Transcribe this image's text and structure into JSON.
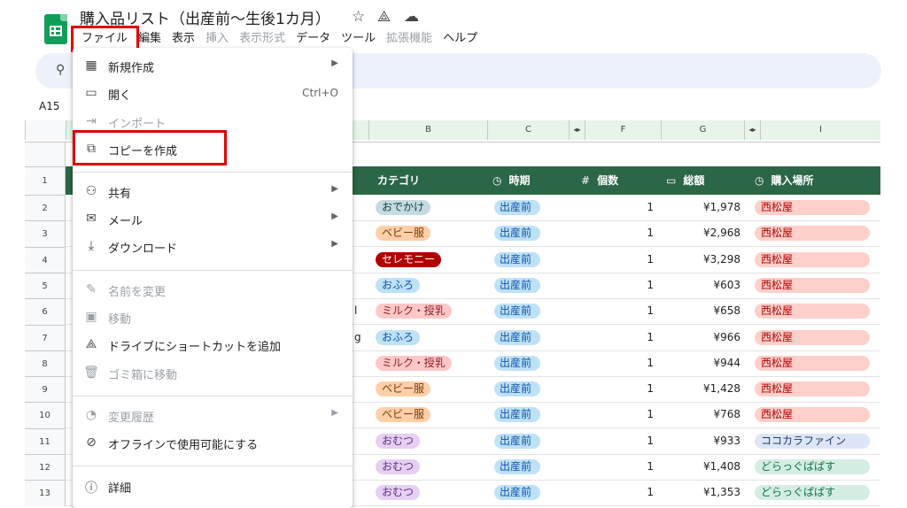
{
  "header": {
    "title": "購入品リスト（出産前〜生後1カ月）",
    "icons": [
      "star-icon",
      "drive-icon",
      "cloud-icon"
    ]
  },
  "menubar": {
    "items": [
      "ファイル",
      "編集",
      "表示",
      "挿入",
      "表示形式",
      "データ",
      "ツール",
      "拡張機能",
      "ヘルプ"
    ]
  },
  "namebox": "A15",
  "columns": [
    "B",
    "C",
    "F",
    "G",
    "I"
  ],
  "table": {
    "headers": [
      "カテゴリ",
      "時期",
      "個数",
      "総額",
      "購入場所"
    ],
    "header_icons": [
      "",
      "◷",
      "#",
      "▭",
      "◷"
    ],
    "partial_col": [
      "",
      "",
      "",
      "",
      "l",
      "g"
    ],
    "rows": [
      {
        "n": "2",
        "category": "おでかけ",
        "period": "出産前",
        "qty": "1",
        "total": "¥1,978",
        "store": "西松屋"
      },
      {
        "n": "3",
        "category": "ベビー服",
        "period": "出産前",
        "qty": "1",
        "total": "¥2,968",
        "store": "西松屋"
      },
      {
        "n": "4",
        "category": "セレモニー",
        "period": "出産前",
        "qty": "1",
        "total": "¥3,298",
        "store": "西松屋"
      },
      {
        "n": "5",
        "category": "おふろ",
        "period": "出産前",
        "qty": "1",
        "total": "¥603",
        "store": "西松屋"
      },
      {
        "n": "6",
        "category": "ミルク・授乳",
        "period": "出産前",
        "qty": "1",
        "total": "¥658",
        "store": "西松屋"
      },
      {
        "n": "7",
        "category": "おふろ",
        "period": "出産前",
        "qty": "1",
        "total": "¥966",
        "store": "西松屋"
      },
      {
        "n": "8",
        "category": "ミルク・授乳",
        "period": "出産前",
        "qty": "1",
        "total": "¥944",
        "store": "西松屋"
      },
      {
        "n": "9",
        "category": "ベビー服",
        "period": "出産前",
        "qty": "1",
        "total": "¥1,428",
        "store": "西松屋"
      },
      {
        "n": "10",
        "category": "ベビー服",
        "period": "出産前",
        "qty": "1",
        "total": "¥768",
        "store": "西松屋"
      },
      {
        "n": "11",
        "category": "おむつ",
        "period": "出産前",
        "qty": "1",
        "total": "¥933",
        "store": "ココカラファイン"
      },
      {
        "n": "12",
        "category": "おむつ",
        "period": "出産前",
        "qty": "1",
        "total": "¥1,408",
        "store": "どらっぐぱぱす"
      },
      {
        "n": "13",
        "category": "おむつ",
        "period": "出産前",
        "qty": "1",
        "total": "¥1,353",
        "store": "どらっぐぱぱす"
      }
    ]
  },
  "category_colors": {
    "おでかけ": {
      "bg": "#c6dbe1",
      "fg": "#0a3d4a"
    },
    "ベビー服": {
      "bg": "#ffcfa8",
      "fg": "#7a3a00"
    },
    "セレモニー": {
      "bg": "#b10202",
      "fg": "#ffffff"
    },
    "おふろ": {
      "bg": "#bfe1f6",
      "fg": "#0a53a8"
    },
    "ミルク・授乳": {
      "bg": "#ffc8c8",
      "fg": "#8a1c1c"
    },
    "おむつ": {
      "bg": "#e6cff2",
      "fg": "#5a3286"
    }
  },
  "store_colors": {
    "西松屋": {
      "bg": "#ffcfc9",
      "fg": "#b10202"
    },
    "ココカラファイン": {
      "bg": "#dce6f7",
      "fg": "#1f3a6b"
    },
    "どらっぐぱぱす": {
      "bg": "#d4ede2",
      "fg": "#11734b"
    }
  },
  "period_color": {
    "bg": "#bfe1f6",
    "fg": "#0a53a8"
  },
  "row_numbers_top": [
    "",
    "1"
  ],
  "file_menu": {
    "items": [
      {
        "label": "新規作成",
        "icon": "new-sheet-icon",
        "glyph": "▦",
        "submenu": true,
        "disabled": false
      },
      {
        "label": "開く",
        "icon": "folder-icon",
        "glyph": "▭",
        "shortcut": "Ctrl+O",
        "disabled": false
      },
      {
        "label": "インポート",
        "icon": "import-icon",
        "glyph": "⇥",
        "disabled": true
      },
      {
        "label": "コピーを作成",
        "icon": "copy-icon",
        "glyph": "⧉",
        "disabled": false
      },
      {
        "label": "共有",
        "icon": "person-add-icon",
        "glyph": "⚇",
        "submenu": true,
        "disabled": false
      },
      {
        "label": "メール",
        "icon": "mail-icon",
        "glyph": "✉",
        "submenu": true,
        "disabled": false
      },
      {
        "label": "ダウンロード",
        "icon": "download-icon",
        "glyph": "⤓",
        "submenu": true,
        "disabled": false
      },
      {
        "label": "名前を変更",
        "icon": "rename-icon",
        "glyph": "✎",
        "disabled": true
      },
      {
        "label": "移動",
        "icon": "move-icon",
        "glyph": "▣",
        "disabled": true
      },
      {
        "label": "ドライブにショートカットを追加",
        "icon": "drive-shortcut-icon",
        "glyph": "⟁",
        "disabled": false
      },
      {
        "label": "ゴミ箱に移動",
        "icon": "trash-icon",
        "glyph": "🗑",
        "disabled": true
      },
      {
        "label": "変更履歴",
        "icon": "history-icon",
        "glyph": "◔",
        "submenu": true,
        "disabled": true
      },
      {
        "label": "オフラインで使用可能にする",
        "icon": "offline-icon",
        "glyph": "⊘",
        "disabled": false
      },
      {
        "label": "詳細",
        "icon": "info-icon",
        "glyph": "ⓘ",
        "disabled": false
      }
    ]
  }
}
